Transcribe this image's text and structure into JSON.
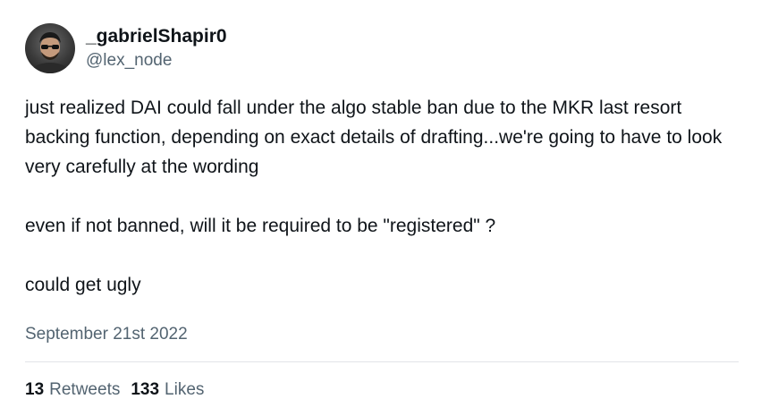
{
  "author": {
    "display_name": "_gabrielShapir0",
    "handle": "@lex_node",
    "avatar_icon": "profile-photo"
  },
  "tweet": {
    "paragraphs": [
      "just realized DAI could fall under the algo stable ban due to the MKR last resort backing function, depending on exact details of drafting...we're going to have to look very carefully at the wording",
      "even if not banned, will it be required to be \"registered\" ?",
      "could get ugly"
    ],
    "date": "September 21st 2022"
  },
  "stats": {
    "retweets_count": "13",
    "retweets_label": "Retweets",
    "likes_count": "133",
    "likes_label": "Likes"
  },
  "colors": {
    "text": "#0f1419",
    "secondary": "#536471",
    "divider": "#e1e4e8"
  }
}
